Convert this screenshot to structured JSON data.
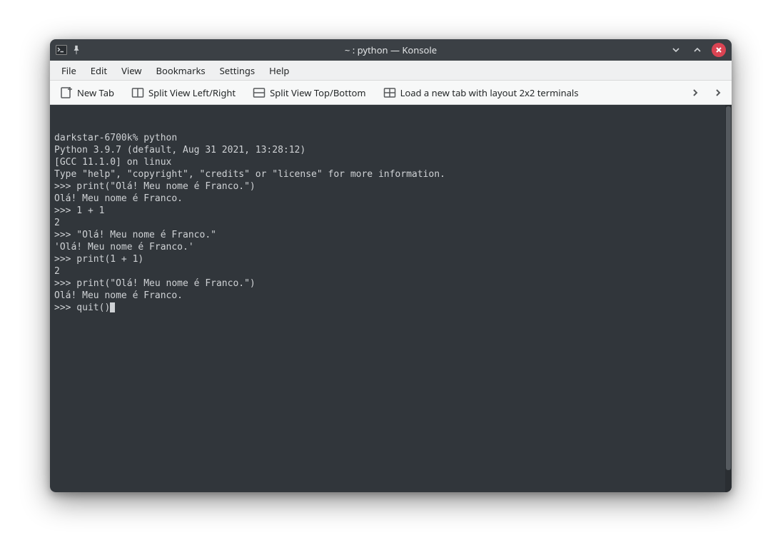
{
  "titlebar": {
    "title": "~ : python — Konsole"
  },
  "menubar": {
    "items": [
      "File",
      "Edit",
      "View",
      "Bookmarks",
      "Settings",
      "Help"
    ]
  },
  "toolbar": {
    "new_tab": "New Tab",
    "split_lr": "Split View Left/Right",
    "split_tb": "Split View Top/Bottom",
    "load_layout": "Load a new tab with layout 2x2 terminals"
  },
  "terminal": {
    "lines": [
      "darkstar-6700k% python",
      "Python 3.9.7 (default, Aug 31 2021, 13:28:12)",
      "[GCC 11.1.0] on linux",
      "Type \"help\", \"copyright\", \"credits\" or \"license\" for more information.",
      ">>> print(\"Olá! Meu nome é Franco.\")",
      "Olá! Meu nome é Franco.",
      ">>> 1 + 1",
      "2",
      ">>> \"Olá! Meu nome é Franco.\"",
      "'Olá! Meu nome é Franco.'",
      ">>> print(1 + 1)",
      "2",
      ">>> print(\"Olá! Meu nome é Franco.\")",
      "Olá! Meu nome é Franco.",
      ">>> quit()"
    ]
  }
}
